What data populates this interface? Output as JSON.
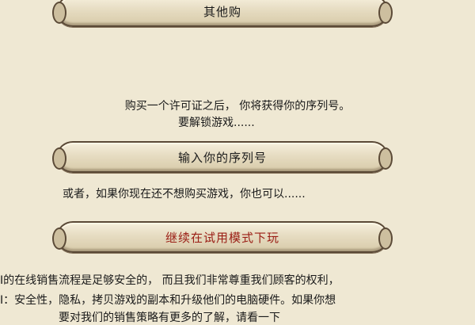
{
  "buttons": {
    "other_buy": "其他购",
    "enter_serial": "输入你的序列号",
    "continue_trial": "继续在试用模式下玩"
  },
  "text": {
    "purchase_info": "购买一个许可证之后， 你将获得你的序列号。",
    "unlock_game": "要解锁游戏......",
    "or_if": "或者，如果你现在还不想购买游戏，你也可以......",
    "security_line1": "I的在线销售流程是足够安全的， 而且我们非常尊重我们顾客的权利，",
    "security_line2": "I：安全性，隐私，拷贝游戏的副本和升级他们的电脑硬件。如果你想",
    "security_line3": "要对我们的销售策略有更多的了解，请看一下"
  },
  "colors": {
    "background": "#efe8d3",
    "trial_label": "#9a1d14",
    "button_border": "#5b4a37"
  }
}
